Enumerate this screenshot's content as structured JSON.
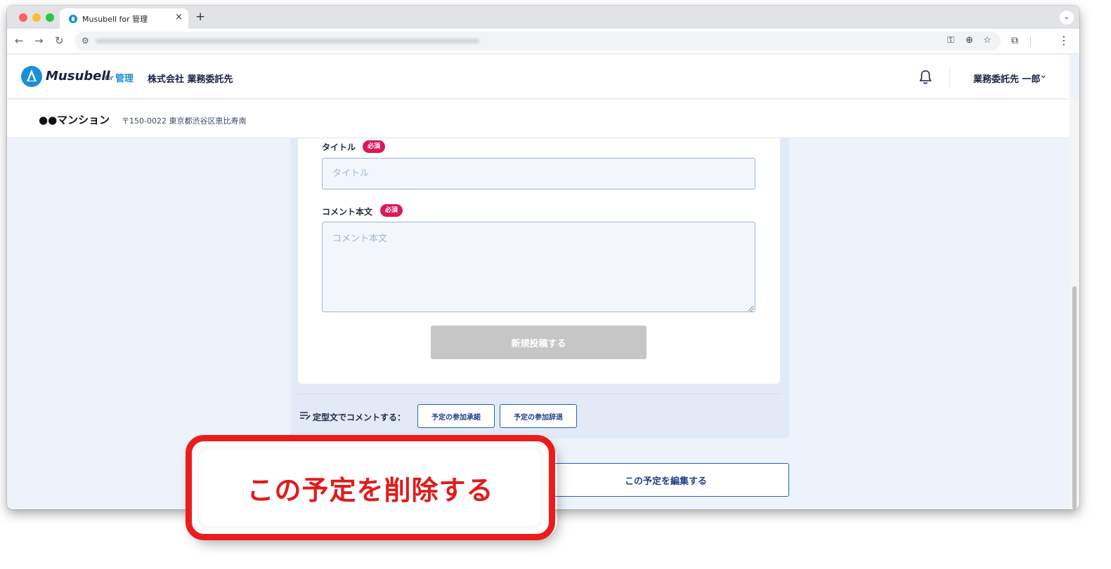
{
  "browser": {
    "tab_title": "Musubell for 管理",
    "tab_close": "×",
    "new_tab": "+",
    "tab_menu": "⌄",
    "nav_back": "←",
    "nav_forward": "→",
    "nav_reload": "↻",
    "site_info": "⚙",
    "omni_key": "⚿",
    "omni_zoom": "⊕",
    "omni_star": "☆",
    "extensions": "⧉",
    "menu": "⋮"
  },
  "header": {
    "logo_text": "Musubell",
    "logo_for": "for",
    "logo_admin": "管理",
    "company": "株式会社 業務委託先",
    "user_name": "業務委託先 一郎",
    "user_chevron": "⌄"
  },
  "property": {
    "name": "●●マンション",
    "address": "〒150-0022 東京都渋谷区恵比寿南"
  },
  "form": {
    "title_label": "タイトル",
    "title_required": "必須",
    "title_placeholder": "タイトル",
    "comment_label": "コメント本文",
    "comment_required": "必須",
    "comment_placeholder": "コメント本文",
    "submit_label": "新規投稿する"
  },
  "templates": {
    "label": "定型文でコメントする：",
    "buttons": [
      "予定の参加承諾",
      "予定の参加辞退"
    ]
  },
  "actions": {
    "edit_label": "この予定を編集する",
    "delete_label": "この予定を削除する"
  },
  "colors": {
    "accent": "#2b5fb8",
    "required_badge": "#d81b5b",
    "callout": "#ec1c1c",
    "brand": "#1a8fd8"
  }
}
